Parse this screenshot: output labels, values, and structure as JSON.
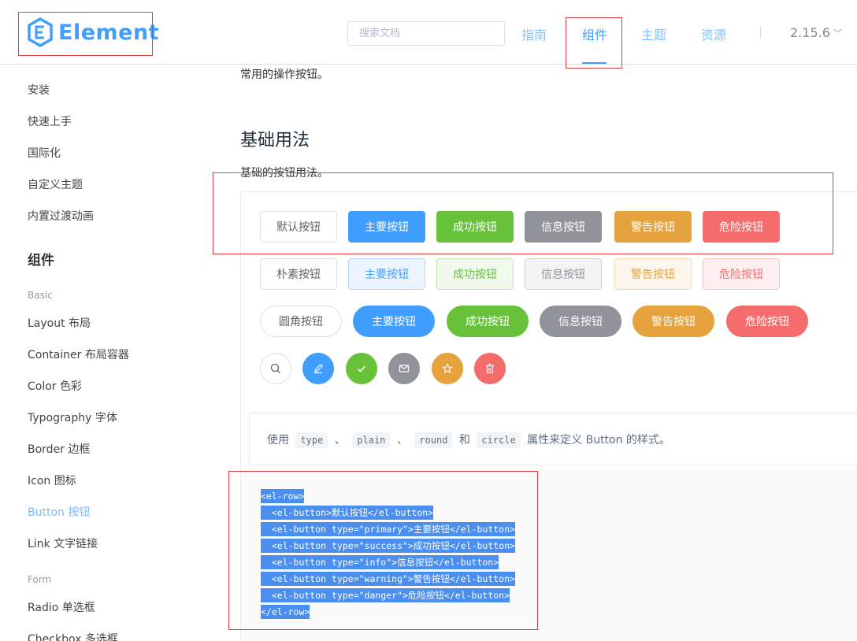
{
  "header": {
    "logo_text": "Element",
    "search_placeholder": "搜索文档",
    "nav": [
      {
        "label": "指南",
        "active": false
      },
      {
        "label": "组件",
        "active": true
      },
      {
        "label": "主题",
        "active": false
      },
      {
        "label": "资源",
        "active": false
      }
    ],
    "version": "2.15.6",
    "accent_color": "#409eff"
  },
  "sidebar": {
    "items": [
      "安装",
      "快速上手",
      "国际化",
      "自定义主题",
      "内置过渡动画"
    ],
    "section_title": "组件",
    "groups": [
      {
        "name": "Basic",
        "items": [
          "Layout 布局",
          "Container 布局容器",
          "Color 色彩",
          "Typography 字体",
          "Border 边框",
          "Icon 图标",
          "Button 按钮",
          "Link 文字链接"
        ]
      },
      {
        "name": "Form",
        "items": [
          "Radio 单选框",
          "Checkbox 多选框"
        ]
      }
    ],
    "active_item": "Button 按钮"
  },
  "main": {
    "intro": "常用的操作按钮。",
    "heading": "基础用法",
    "description": "基础的按钮用法。",
    "rows": {
      "default": [
        "默认按钮",
        "主要按钮",
        "成功按钮",
        "信息按钮",
        "警告按钮",
        "危险按钮"
      ],
      "plain": [
        "朴素按钮",
        "主要按钮",
        "成功按钮",
        "信息按钮",
        "警告按钮",
        "危险按钮"
      ],
      "round": [
        "圆角按钮",
        "主要按钮",
        "成功按钮",
        "信息按钮",
        "警告按钮",
        "危险按钮"
      ],
      "circle_icons": [
        "search-icon",
        "edit-icon",
        "check-icon",
        "message-icon",
        "star-icon",
        "delete-icon"
      ]
    },
    "meta": {
      "prefix": "使用",
      "codes": [
        "type",
        "plain",
        "round",
        "circle"
      ],
      "sep1": "、",
      "sep2": "、",
      "and": "和",
      "suffix": "属性来定义 Button 的样式。"
    },
    "code_lines": [
      "<el-row>",
      "  <el-button>默认按钮</el-button>",
      "  <el-button type=\"primary\">主要按钮</el-button>",
      "  <el-button type=\"success\">成功按钮</el-button>",
      "  <el-button type=\"info\">信息按钮</el-button>",
      "  <el-button type=\"warning\">警告按钮</el-button>",
      "  <el-button type=\"danger\">危险按钮</el-button>",
      "</el-row>"
    ]
  },
  "colors": {
    "primary": "#409eff",
    "success": "#67c23a",
    "info": "#909399",
    "warning": "#e6a23c",
    "danger": "#f56c6c",
    "annotation": "#e23b3b"
  }
}
